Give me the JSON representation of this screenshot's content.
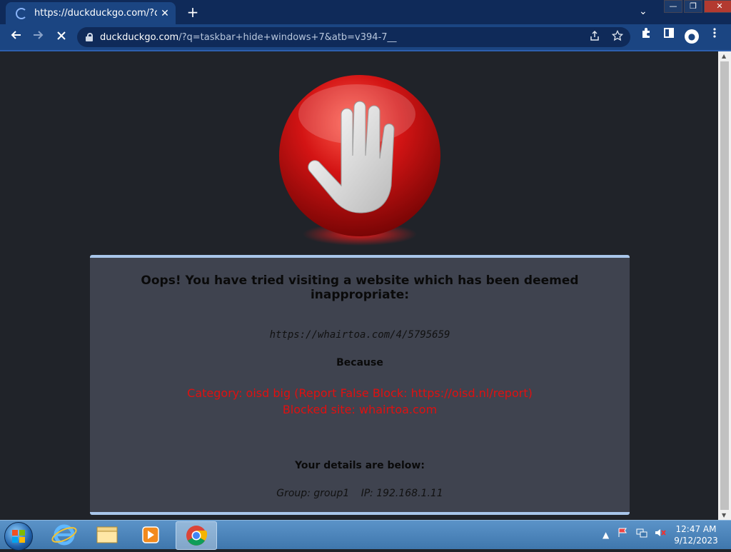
{
  "browser": {
    "tab_title": "https://duckduckgo.com/?q=task",
    "tab_close": "✕",
    "new_tab": "+",
    "tab_menu": "⌄",
    "url_domain": "duckduckgo.com",
    "url_rest": "/?q=taskbar+hide+windows+7&atb=v394-7__",
    "window_controls": {
      "minimize": "—",
      "restore": "❐",
      "close": "✕"
    }
  },
  "page": {
    "heading": "Oops! You have tried visiting a website which has been deemed inappropriate:",
    "blocked_url": "https://whairtoa.com/4/5795659",
    "because_label": "Because",
    "reason_line1": "Category: oisd big (Report False Block: https://oisd.nl/report)",
    "reason_line2": "Blocked site: whairtoa.com",
    "details_label": "Your details are below:",
    "group": "Group: group1",
    "ip": "IP: 192.168.1.11"
  },
  "taskbar": {
    "time": "12:47 AM",
    "date": "9/12/2023",
    "icons": [
      "windows-start-icon",
      "internet-explorer-icon",
      "file-explorer-icon",
      "media-player-icon",
      "chrome-icon"
    ]
  },
  "colors": {
    "accent": "#1b4582",
    "panel_bg": "#3f434f",
    "panel_border": "#a9c6ea",
    "reason_red": "#e01010",
    "stop_red": "#d11212"
  }
}
